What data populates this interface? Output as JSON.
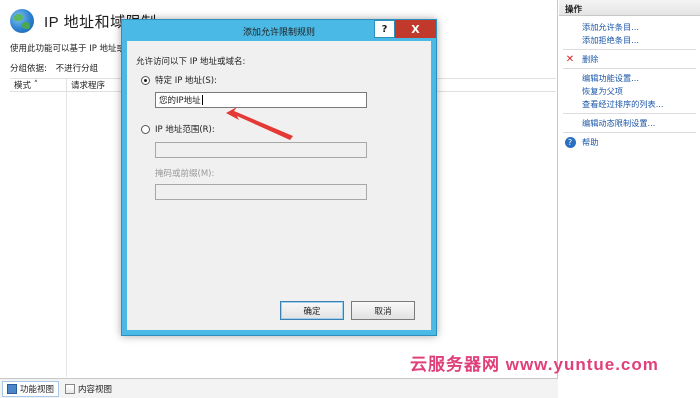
{
  "main": {
    "title": "IP 地址和域限制",
    "description": "使用此功能可以基于 IP 地址或",
    "group_by_label": "分组依据:",
    "group_by_value": "不进行分组",
    "columns": [
      "模式",
      "请求程序"
    ]
  },
  "bottom_tabs": [
    {
      "label": "功能视图",
      "active": true
    },
    {
      "label": "内容视图",
      "active": false
    }
  ],
  "actions": {
    "header": "操作",
    "items": [
      {
        "label": "添加允许条目...",
        "icon": ""
      },
      {
        "label": "添加拒绝条目...",
        "icon": ""
      },
      {
        "label": "删除",
        "icon": "delete-icon"
      },
      {
        "label": "编辑功能设置...",
        "icon": ""
      },
      {
        "label": "恢复为父项",
        "icon": ""
      },
      {
        "label": "查看经过排序的列表...",
        "icon": ""
      },
      {
        "label": "编辑动态限制设置...",
        "icon": ""
      },
      {
        "label": "帮助",
        "icon": "help-icon"
      }
    ]
  },
  "dialog": {
    "title": "添加允许限制规则",
    "help_button": "?",
    "close_button": "X",
    "prompt": "允许访问以下 IP 地址或域名:",
    "radio_specific": "特定 IP 地址(S):",
    "specific_value": "您的IP地址",
    "radio_range": "IP 地址范围(R):",
    "range_value": "",
    "mask_label": "掩码或前缀(M):",
    "mask_value": "",
    "ok": "确定",
    "cancel": "取消",
    "selected_radio": "specific"
  },
  "watermark": "云服务器网 www.yuntue.com",
  "colors": {
    "dialog_frame": "#4bb9e6",
    "close_button": "#c0392b",
    "link": "#1a56a8",
    "annotation_arrow": "#e53935",
    "watermark": "#e0407a"
  }
}
